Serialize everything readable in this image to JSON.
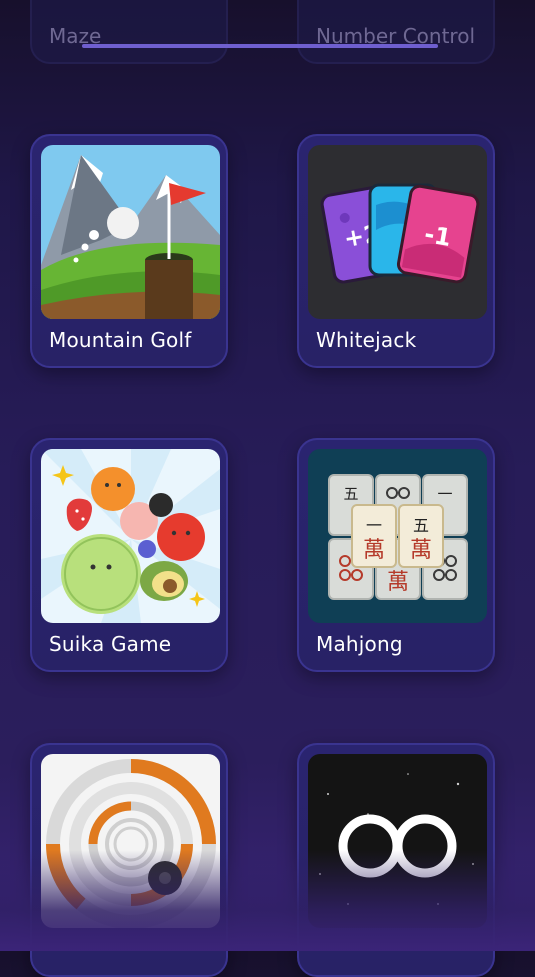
{
  "top_row": {
    "left_label": "Maze",
    "right_label": "Number Control"
  },
  "games": [
    {
      "label": "Mountain Golf"
    },
    {
      "label": "Whitejack",
      "cards": [
        "+2",
        "-1"
      ]
    },
    {
      "label": "Suika Game"
    },
    {
      "label": "Mahjong",
      "tiles": [
        "五",
        "一",
        "萬"
      ]
    },
    {
      "label": ""
    },
    {
      "label": ""
    }
  ],
  "colors": {
    "background": "#271c58",
    "card": "#2a2470",
    "card_border": "#3a3490",
    "scrollbar": "#6f5fcf"
  }
}
